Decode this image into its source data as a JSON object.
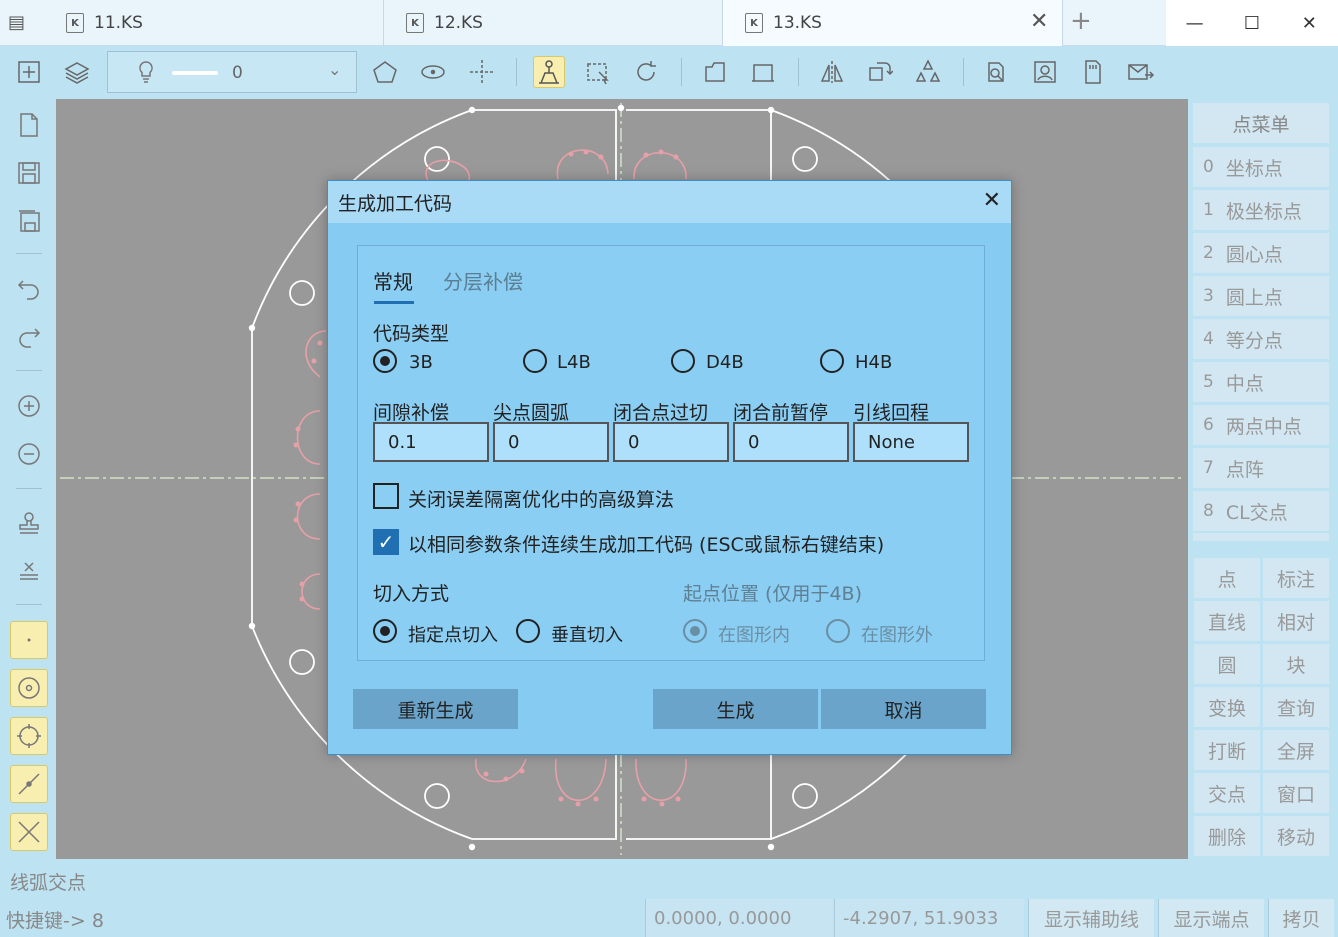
{
  "tabs": [
    {
      "label": "11.KS",
      "icon": "doc-icon"
    },
    {
      "label": "12.KS",
      "icon": "doc-icon"
    },
    {
      "label": "13.KS",
      "icon": "doc-icon"
    }
  ],
  "layer": {
    "value": "0"
  },
  "point_menu": {
    "header": "点菜单",
    "items": [
      {
        "num": "0",
        "label": "坐标点"
      },
      {
        "num": "1",
        "label": "极坐标点"
      },
      {
        "num": "2",
        "label": "圆心点"
      },
      {
        "num": "3",
        "label": "圆上点"
      },
      {
        "num": "4",
        "label": "等分点"
      },
      {
        "num": "5",
        "label": "中点"
      },
      {
        "num": "6",
        "label": "两点中点"
      },
      {
        "num": "7",
        "label": "点阵"
      },
      {
        "num": "8",
        "label": "CL交点"
      }
    ]
  },
  "commands": [
    "点",
    "标注",
    "直线",
    "相对",
    "圆",
    "块",
    "变换",
    "查询",
    "打断",
    "全屏",
    "交点",
    "窗口",
    "删除",
    "移动"
  ],
  "status": {
    "prompt": "线弧交点",
    "shortcut": "快捷键-> 8",
    "coord_origin": "0.0000, 0.0000",
    "coord_cursor": "-4.2907, 51.9033",
    "btn_aux": "显示辅助线",
    "btn_endpoints": "显示端点",
    "btn_copy": "拷贝"
  },
  "dialog": {
    "title": "生成加工代码",
    "tabs": [
      "常规",
      "分层补偿"
    ],
    "code_type_label": "代码类型",
    "code_types": [
      {
        "label": "3B",
        "selected": true
      },
      {
        "label": "L4B",
        "selected": false
      },
      {
        "label": "D4B",
        "selected": false
      },
      {
        "label": "H4B",
        "selected": false
      }
    ],
    "fields": [
      {
        "label": "间隙补偿",
        "value": "0.1"
      },
      {
        "label": "尖点圆弧",
        "value": "0"
      },
      {
        "label": "闭合点过切",
        "value": "0"
      },
      {
        "label": "闭合前暂停",
        "value": "0"
      },
      {
        "label": "引线回程",
        "value": "None"
      }
    ],
    "check1": {
      "label": "关闭误差隔离优化中的高级算法",
      "checked": false
    },
    "check2": {
      "label": "以相同参数条件连续生成加工代码 (ESC或鼠标右键结束)",
      "checked": true
    },
    "entry_label": "切入方式",
    "entry_options": [
      {
        "label": "指定点切入",
        "selected": true
      },
      {
        "label": "垂直切入",
        "selected": false
      }
    ],
    "start_label": "起点位置 (仅用于4B)",
    "start_options": [
      {
        "label": "在图形内",
        "selected": true
      },
      {
        "label": "在图形外",
        "selected": false
      }
    ],
    "btn_regen": "重新生成",
    "btn_generate": "生成",
    "btn_cancel": "取消"
  },
  "colors": {
    "canvas": "#999999",
    "outline": "#ffffff",
    "slots": "#e8a0a8",
    "centerline": "#cfe3c8",
    "dialog_bg": "#86cbf1",
    "button_bg": "#6aa4cb",
    "accent": "#1f6fb2"
  }
}
